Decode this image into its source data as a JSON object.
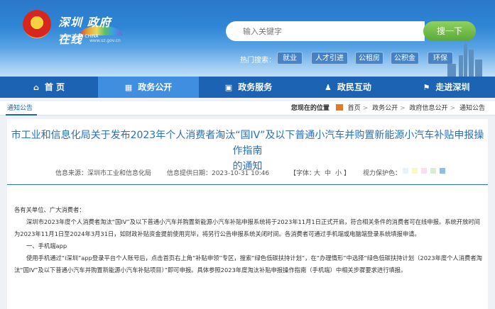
{
  "header": {
    "logo_text": "深圳 政府在线",
    "logo_en": "SHENZHEN CHINA",
    "logo_url": "www.sz.gov.cn",
    "search_placeholder": "输入关键字",
    "search_button": "搜一下",
    "hot_label": "热门搜索：",
    "hot_tags": [
      "就业",
      "人才引进",
      "公租房",
      "公积金",
      "环保"
    ]
  },
  "nav": {
    "items": [
      {
        "label": "首 页",
        "icon": "home-icon",
        "glyph": "⌂"
      },
      {
        "label": "政务公开",
        "icon": "grid-icon",
        "glyph": "▦"
      },
      {
        "label": "政务服务",
        "icon": "service-icon",
        "glyph": "▣"
      },
      {
        "label": "政民互动",
        "icon": "people-icon",
        "glyph": "♟"
      },
      {
        "label": "走进深圳",
        "icon": "flag-icon",
        "glyph": "⚑"
      }
    ],
    "active_index": 1
  },
  "breadcrumb": {
    "section": "通知公告",
    "location_label": "您现在的位置",
    "path": [
      "首页",
      "政务公开",
      "政府信息公开",
      "通知公告"
    ]
  },
  "article": {
    "title_line1": "市工业和信息化局关于发布2023年个人消费者淘汰“国IV”及以下普通小汽车并购置新能源小汽车补贴申报操作指南",
    "title_line2": "的通知",
    "source": "信息来源：深圳市工业和信息化局",
    "date": "信息提供日期：2023-10-31 10:46",
    "font_label": "【字体：",
    "font_sizes": [
      "大",
      "中",
      "小"
    ],
    "font_close": "】",
    "eye_label": "视力保护色：",
    "eye_colors": [
      "#e6f2fb",
      "#fbf6c8",
      "#f6dff0",
      "#d9ecd6",
      "#8fbde9"
    ],
    "greeting": "各有关单位、广大消费者：",
    "para1": "深圳市2023年度个人消费者淘汰“国IV”及以下普通小汽车并购置新能源小汽车补贴申报系统将于2023年11月1日正式开启，符合相关条件的消费者可在线申报。系统开放时间为2023年11月1日至2024年3月31日，如财政补贴资金提前使用完毕，将另行公告申报系统关闭时间。各消费者可通过手机端或电脑端登录系统填报申请。",
    "section1": "一、手机端app",
    "para2": "使用手机通过“i深圳”app登录平台个人账号后，点击首页右上角“补贴申领”专区，搜索“绿色低碳扶持计划”，在“办理情形”中选择“绿色低碳扶持计划（2023年度个人消费者淘汰“国IV”及以下普通小汽车并购置新能源小汽车补贴项目）”即可申报。具体参照2023年度淘汰补贴申报操作指南（手机端）中相关步骤要求进行填报。"
  }
}
